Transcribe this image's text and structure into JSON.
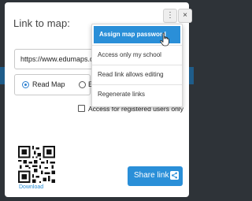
{
  "dialog": {
    "title": "Link to map:",
    "more_icon": "⋮",
    "close_icon": "×",
    "partial_link_text": "nk",
    "url_value": "https://www.edumaps.c",
    "side_mark": "a",
    "read_map_label": "Read Map",
    "other_option_label": "E",
    "registered_only_label": "Access for registered users only",
    "download_label": "Download",
    "share_button_label": "Share link"
  },
  "menu": {
    "items": [
      {
        "label": "Assign map password"
      },
      {
        "label": "Access only my school"
      },
      {
        "label": "Read link allows editing"
      },
      {
        "label": "Regenerate links"
      }
    ]
  },
  "colors": {
    "accent": "#2a8fd8",
    "link": "#2b8fd6"
  },
  "icons": [
    "more-vertical-icon",
    "close-icon",
    "share-icon",
    "qr-code-icon",
    "hand-cursor-icon"
  ]
}
